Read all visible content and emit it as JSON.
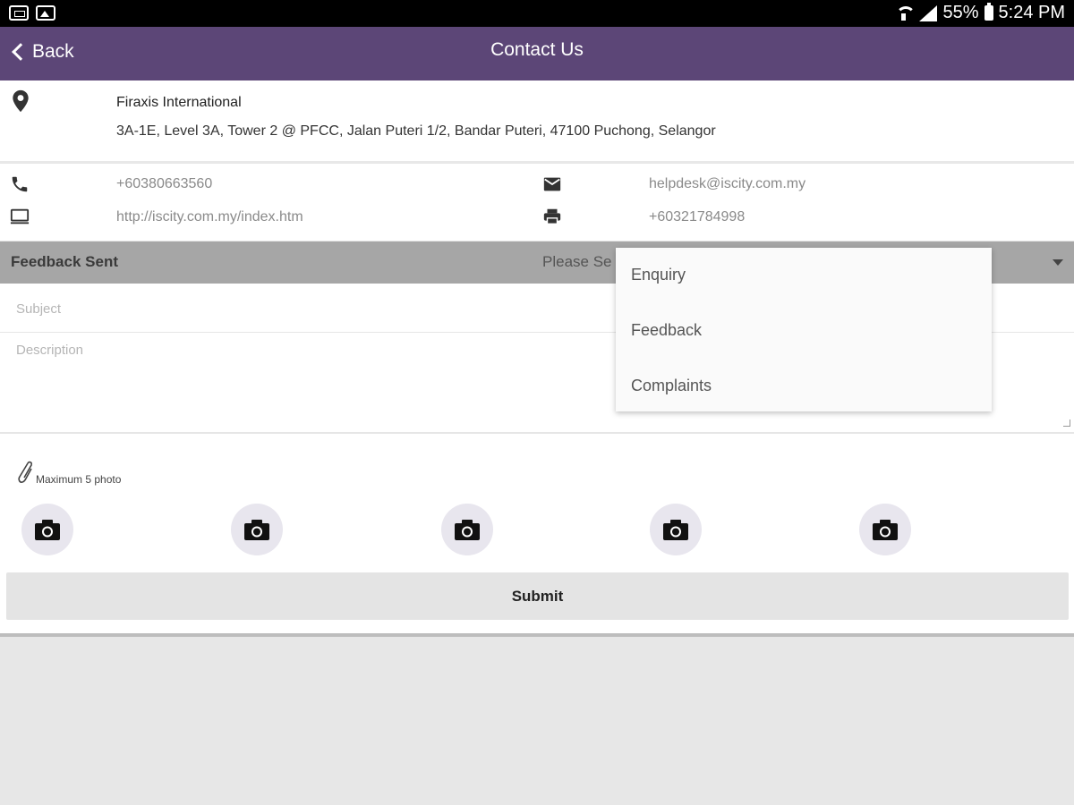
{
  "status_bar": {
    "battery": "55%",
    "time": "5:24 PM"
  },
  "header": {
    "back_label": "Back",
    "title": "Contact Us"
  },
  "address": {
    "name": "Firaxis International",
    "line": "3A-1E, Level 3A, Tower 2 @ PFCC, Jalan Puteri 1/2, Bandar Puteri, 47100 Puchong, Selangor"
  },
  "contacts": {
    "phone": "+60380663560",
    "email": "helpdesk@iscity.com.my",
    "website": "http://iscity.com.my/index.htm",
    "fax": "+60321784998"
  },
  "feedback": {
    "title": "Feedback Sent",
    "select_placeholder": "Please Se"
  },
  "form": {
    "subject_placeholder": "Subject",
    "description_placeholder": "Description",
    "attach_label": "Maximum 5 photo",
    "submit_label": "Submit"
  },
  "dropdown": {
    "options": [
      "Enquiry",
      "Feedback",
      "Complaints"
    ]
  },
  "colors": {
    "header": "#5c4677",
    "feedback_bar": "#a6a6a6"
  },
  "icons": [
    "location-pin-icon",
    "phone-icon",
    "mail-icon",
    "monitor-icon",
    "printer-icon",
    "paperclip-icon",
    "camera-icon"
  ]
}
